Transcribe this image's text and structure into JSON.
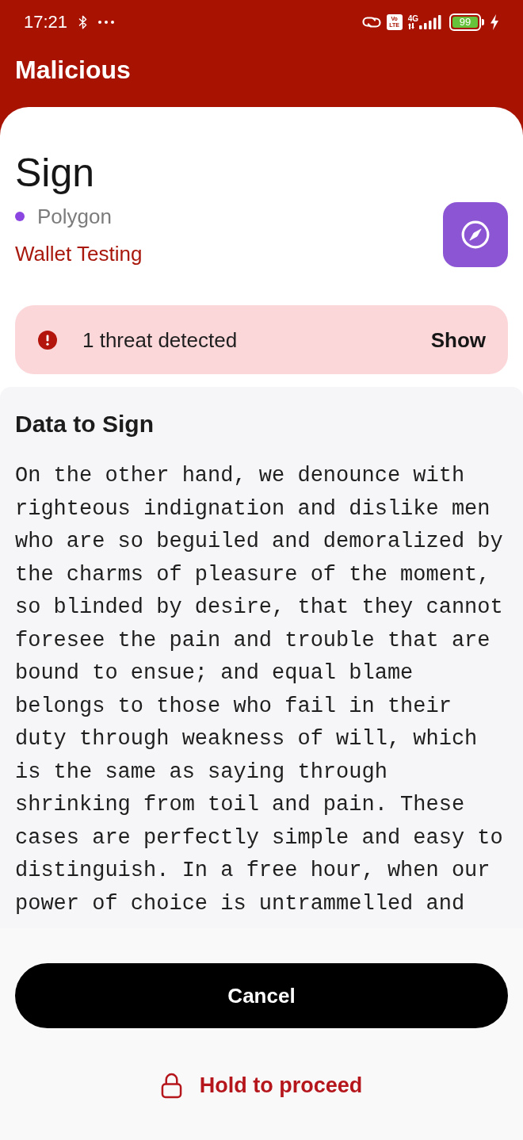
{
  "status_bar": {
    "time": "17:21",
    "volte": [
      "Vo",
      "LTE"
    ],
    "network_type": "4G",
    "battery": "99"
  },
  "header": {
    "title": "Malicious"
  },
  "request": {
    "title": "Sign",
    "network": {
      "name": "Polygon",
      "color": "#8b45e0"
    },
    "dapp": "Wallet Testing"
  },
  "threat_banner": {
    "message": "1 threat detected",
    "action": "Show"
  },
  "data_section": {
    "title": "Data to Sign",
    "content": "On the other hand, we denounce with righteous indignation and dislike men who are so beguiled and demoralized by the charms of pleasure of the moment, so blinded by desire, that they cannot foresee the pain and trouble that are bound to ensue; and equal blame belongs to those who fail in their duty through weakness of will, which is the same as saying through shrinking from toil and pain. These cases are perfectly simple and easy to distinguish. In a free hour, when our power of choice is untrammelled and"
  },
  "buttons": {
    "cancel": "Cancel",
    "proceed": "Hold to proceed"
  }
}
